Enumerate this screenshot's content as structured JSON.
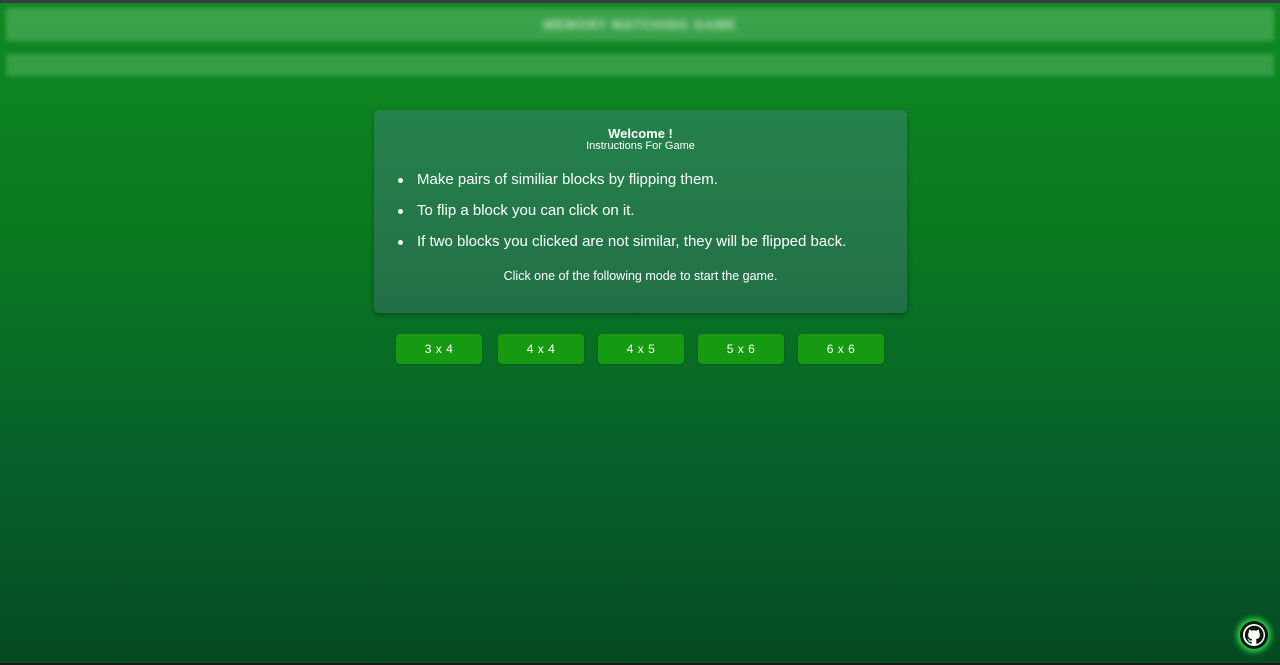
{
  "header": {
    "title": "MEMORY MATCHING GAME"
  },
  "panel": {
    "title": "Welcome !",
    "subtitle": "Instructions For Game",
    "rules": [
      "Make pairs of similiar blocks by flipping them.",
      "To flip a block you can click on it.",
      "If two blocks you clicked are not similar, they will be flipped back."
    ],
    "footer": "Click one of the following mode to start the game."
  },
  "modes": [
    "3 x 4",
    "4 x 4",
    "4 x 5",
    "5 x 6",
    "6 x 6"
  ],
  "github": {
    "icon": "github-icon"
  },
  "colors": {
    "background": "#0a7a20",
    "panel": "#24824a",
    "button": "#159a12",
    "github_glow": "#2bd64a"
  }
}
